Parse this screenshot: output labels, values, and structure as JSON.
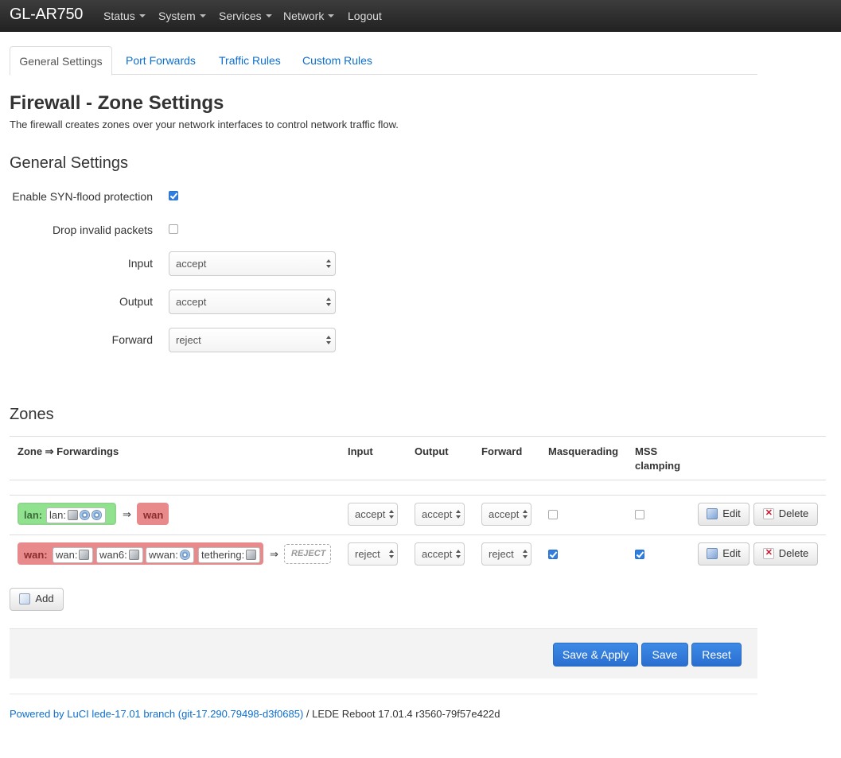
{
  "navbar": {
    "brand": "GL-AR750",
    "menus": [
      "Status",
      "System",
      "Services",
      "Network"
    ],
    "logout": "Logout"
  },
  "tabs": [
    "General Settings",
    "Port Forwards",
    "Traffic Rules",
    "Custom Rules"
  ],
  "page": {
    "title": "Firewall - Zone Settings",
    "description": "The firewall creates zones over your network interfaces to control network traffic flow."
  },
  "general": {
    "heading": "General Settings",
    "syn_flood_label": "Enable SYN-flood protection",
    "syn_flood_checked": true,
    "drop_invalid_label": "Drop invalid packets",
    "drop_invalid_checked": false,
    "input_label": "Input",
    "input_value": "accept",
    "output_label": "Output",
    "output_value": "accept",
    "forward_label": "Forward",
    "forward_value": "reject"
  },
  "zones": {
    "heading": "Zones",
    "columns": [
      "Zone ⇒ Forwardings",
      "Input",
      "Output",
      "Forward",
      "Masquerading",
      "MSS",
      "clamping"
    ],
    "rows": [
      {
        "zone": "lan:",
        "interfaces": [
          "lan:"
        ],
        "arrow": "⇒",
        "target": "wan",
        "input": "accept",
        "output": "accept",
        "forward": "accept",
        "masquerading": false,
        "mss_clamping": false
      },
      {
        "zone": "wan:",
        "interfaces": [
          "wan:",
          "wan6:",
          "wwan:",
          "tethering:"
        ],
        "arrow": "⇒",
        "target": "REJECT",
        "input": "reject",
        "output": "accept",
        "forward": "reject",
        "masquerading": true,
        "mss_clamping": true
      }
    ],
    "edit_label": "Edit",
    "delete_label": "Delete",
    "add_label": "Add"
  },
  "actions": {
    "save_apply": "Save & Apply",
    "save": "Save",
    "reset": "Reset"
  },
  "footer": {
    "link": "Powered by LuCI lede-17.01 branch (git-17.290.79498-d3f0685)",
    "text": " / LEDE Reboot 17.01.4 r3560-79f57e422d"
  },
  "colors": {
    "lan_zone": "#90e28f",
    "wan_zone": "#e8898b",
    "primary_button": "#2f7ee0",
    "link": "#0d6fcf"
  }
}
